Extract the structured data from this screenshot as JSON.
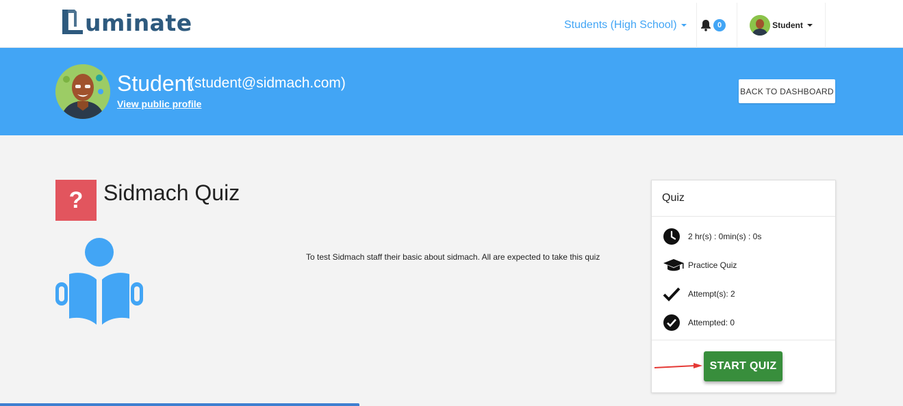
{
  "brand": {
    "name": "uminate"
  },
  "nav": {
    "school_label": "Students (High School)",
    "notifications_count": "0",
    "user_label": "Student"
  },
  "profile": {
    "name": "Student",
    "email": "(student@sidmach.com)",
    "public_link": "View public profile",
    "back_button": "BACK TO DASHBOARD"
  },
  "quiz": {
    "icon_glyph": "?",
    "title": "Sidmach Quiz",
    "description": "To test Sidmach staff their basic about sidmach. All are expected to take this quiz"
  },
  "card": {
    "header": "Quiz",
    "items": [
      {
        "icon": "clock-icon",
        "text": "2 hr(s) : 0min(s) : 0s"
      },
      {
        "icon": "graduation-cap-icon",
        "text": "Practice Quiz"
      },
      {
        "icon": "checkmark-icon",
        "text": "Attempt(s): 2"
      },
      {
        "icon": "check-circle-icon",
        "text": "Attempted: 0"
      }
    ],
    "start_button": "START QUIZ"
  },
  "colors": {
    "primary": "#42a5f5",
    "quiz_icon_bg": "#e2555e",
    "start_button": "#388e3c",
    "annotation_arrow": "#e53935"
  }
}
